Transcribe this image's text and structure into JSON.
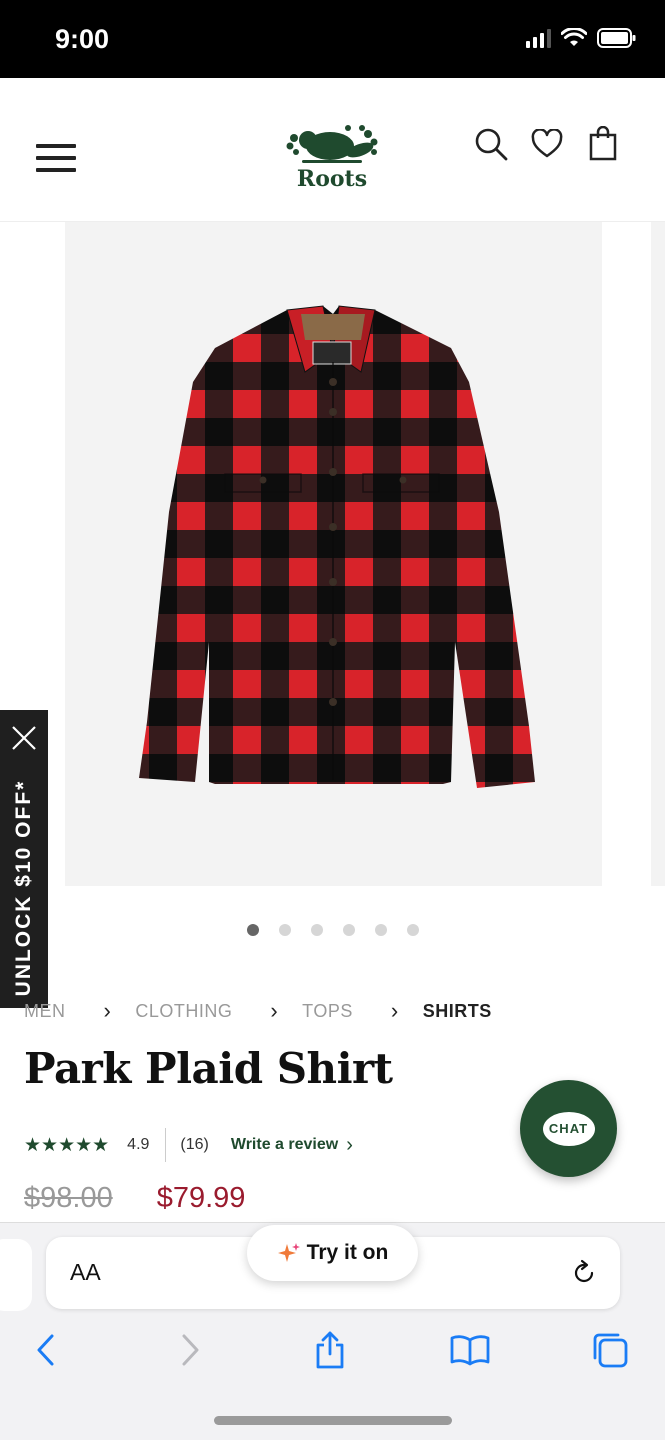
{
  "status_bar": {
    "time": "9:00"
  },
  "header": {
    "logo_text": "Roots",
    "icons": [
      "menu-icon",
      "search-icon",
      "heart-icon",
      "bag-icon"
    ]
  },
  "promo_tab": {
    "label": "UNLOCK $10 OFF*",
    "close_icon": "close-icon"
  },
  "gallery": {
    "total_images": 6,
    "active_index": 0
  },
  "breadcrumb": {
    "items": [
      "MEN",
      "CLOTHING",
      "TOPS",
      "SHIRTS"
    ]
  },
  "product": {
    "title": "Park Plaid Shirt",
    "rating": "4.9",
    "stars": "★★★★★",
    "review_count": "(16)",
    "write_review": "Write a review",
    "old_price": "$98.00",
    "new_price": "$79.99"
  },
  "chat": {
    "label": "CHAT"
  },
  "browser": {
    "aa_label": "AA",
    "try_it_on": "Try it on"
  },
  "colors": {
    "brand_green": "#245032",
    "sale_red": "#9a1b2e",
    "plaid_red": "#d8232a",
    "plaid_black": "#111111"
  }
}
